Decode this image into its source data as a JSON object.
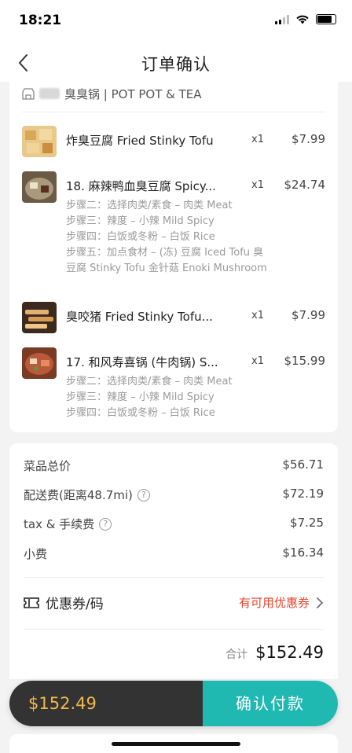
{
  "status_bar": {
    "time": "18:21"
  },
  "nav": {
    "title": "订单确认"
  },
  "store": {
    "name": "臭臭锅 | POT POT & TEA"
  },
  "items": [
    {
      "name": "炸臭豆腐 Fried Stinky Tofu",
      "qty": "x1",
      "price": "$7.99",
      "options": []
    },
    {
      "name": "18. 麻辣鸭血臭豆腐 Spicy...",
      "qty": "x1",
      "price": "$24.74",
      "options": [
        "步骤二：选择肉类/素食 – 肉类 Meat",
        "步骤三：辣度 – 小辣 Mild Spicy",
        "步骤四：白饭或冬粉 – 白饭 Rice",
        "步骤五：加点食材 – (冻) 豆腐 Iced Tofu 臭豆腐 Stinky Tofu 金针菇 Enoki Mushroom"
      ]
    },
    {
      "name": "臭咬猪 Fried Stinky Tofu...",
      "qty": "x1",
      "price": "$7.99",
      "options": []
    },
    {
      "name": "17. 和风寿喜锅 (牛肉锅) S...",
      "qty": "x1",
      "price": "$15.99",
      "options": [
        "步骤二：选择肉类/素食 – 肉类 Meat",
        "步骤三：辣度 – 小辣 Mild Spicy",
        "步骤四：白饭或冬粉 – 白饭 Rice"
      ]
    }
  ],
  "summary": {
    "subtotal_label": "菜品总价",
    "subtotal": "$56.71",
    "delivery_label": "配送费(距离48.7mi)",
    "delivery": "$72.19",
    "tax_label": "tax & 手续费",
    "tax": "$7.25",
    "tip_label": "小费",
    "tip": "$16.34"
  },
  "coupon": {
    "label": "优惠券/码",
    "available": "有可用优惠券"
  },
  "total": {
    "label": "合计",
    "value": "$152.49"
  },
  "pay_bar": {
    "amount": "$152.49",
    "button": "确认付款"
  },
  "colors": {
    "accent": "#20b9b1",
    "amount": "#f0b84a",
    "coupon": "#e8432b"
  }
}
